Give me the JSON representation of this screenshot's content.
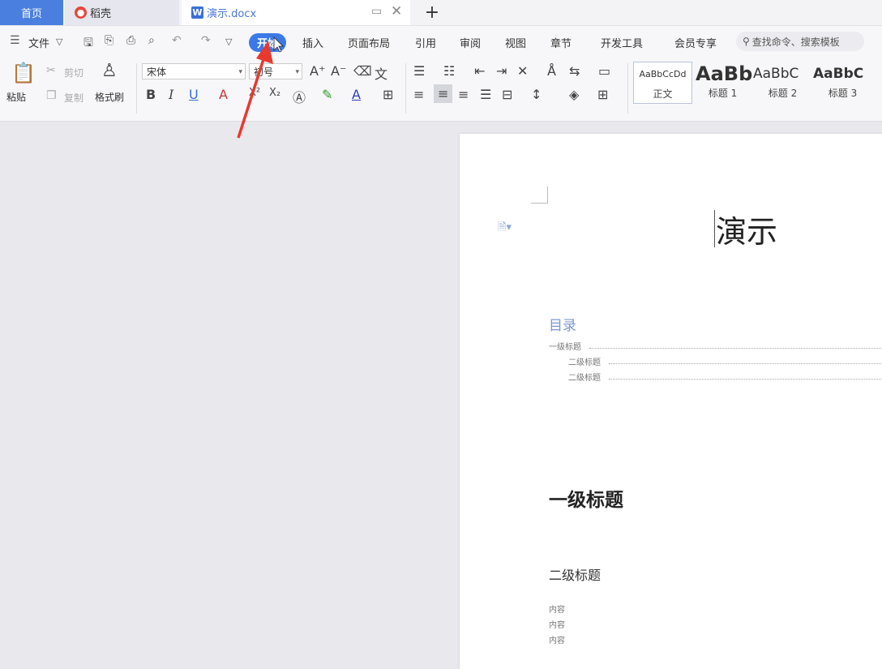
{
  "tabs": {
    "home": "首页",
    "daoke": "稻壳",
    "document": "演示.docx",
    "add": "+"
  },
  "menu": {
    "file": "文件",
    "start": "开始",
    "insert": "插入",
    "page_layout": "页面布局",
    "references": "引用",
    "review": "审阅",
    "view": "视图",
    "chapter": "章节",
    "developer": "开发工具",
    "member": "会员专享",
    "search_placeholder": "查找命令、搜索模板"
  },
  "ribbon": {
    "paste": "粘贴",
    "cut": "剪切",
    "copy": "复制",
    "format_painter": "格式刷",
    "font_name": "宋体",
    "font_size": "初号",
    "styles": [
      {
        "sample": "AaBbCcDd",
        "caption": "正文"
      },
      {
        "sample": "AaBb",
        "caption": "标题 1"
      },
      {
        "sample": "AaBbC",
        "caption": "标题 2"
      },
      {
        "sample": "AaBbC",
        "caption": "标题 3"
      }
    ]
  },
  "document": {
    "title": "演示",
    "toc_heading": "目录",
    "toc": [
      {
        "text": "一级标题",
        "level": 1
      },
      {
        "text": "二级标题",
        "level": 2
      },
      {
        "text": "二级标题",
        "level": 2
      }
    ],
    "heading1": "一级标题",
    "heading2": "二级标题",
    "body": [
      "内容",
      "内容",
      "内容"
    ]
  },
  "colors": {
    "accent": "#3b7ae6",
    "annotation_arrow": "#e8392f",
    "toc_heading": "#7b98cf"
  },
  "icons": [
    "menu-icon",
    "save-icon",
    "undo-icon",
    "redo-icon",
    "print-icon",
    "search-icon",
    "paste-icon",
    "cut-icon",
    "copy-icon",
    "format-painter-icon"
  ]
}
